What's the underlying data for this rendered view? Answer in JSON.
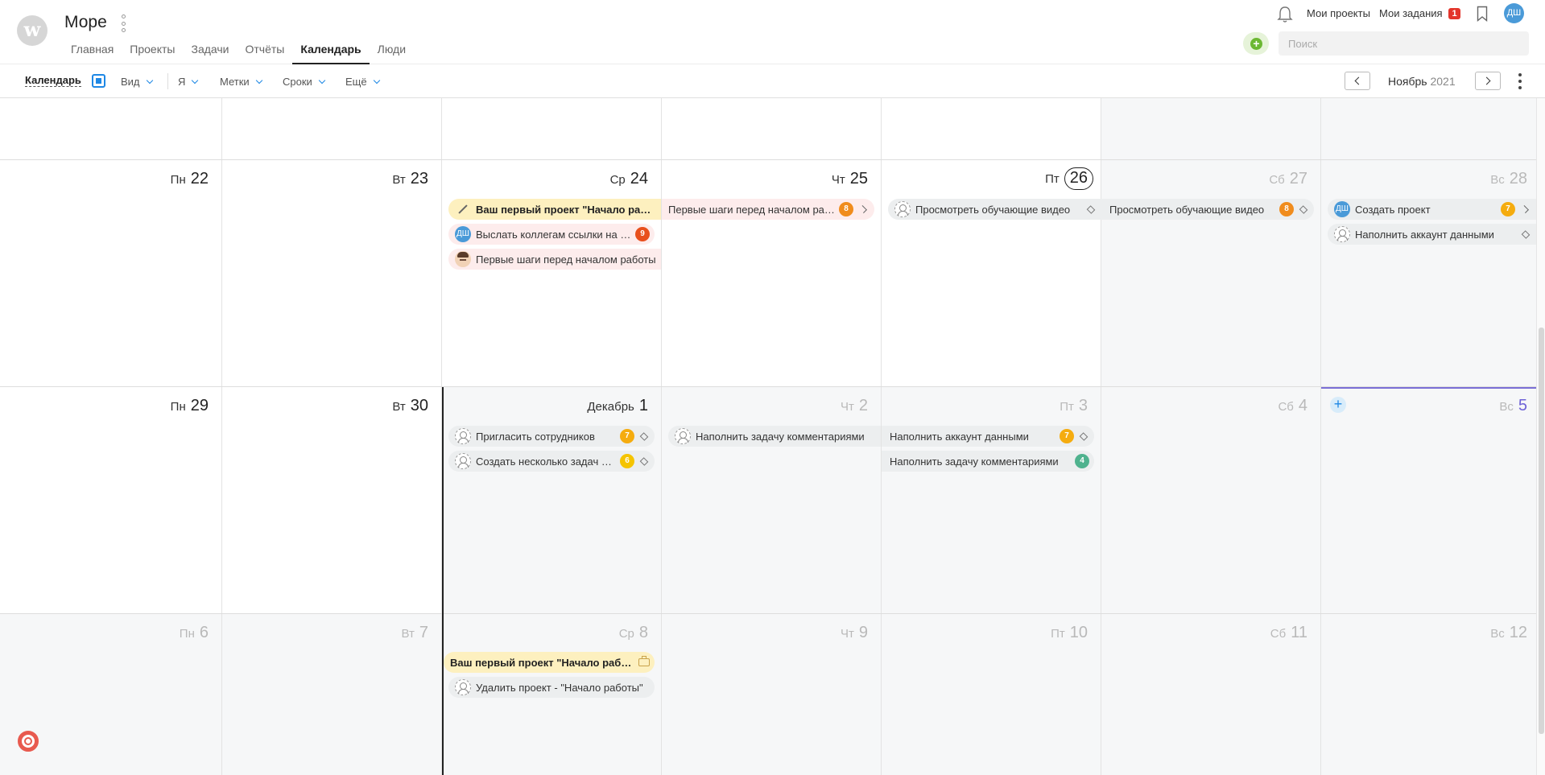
{
  "header": {
    "logo_letter": "w",
    "project_title": "Море",
    "nav": [
      "Главная",
      "Проекты",
      "Задачи",
      "Отчёты",
      "Календарь",
      "Люди"
    ],
    "active_nav": "Календарь",
    "my_projects": "Мои проекты",
    "my_tasks": "Мои задания",
    "my_tasks_count": "1",
    "user_initials": "ДШ",
    "search_placeholder": "Поиск"
  },
  "toolbar": {
    "calendar_label": "Календарь",
    "filters": [
      "Вид",
      "Я",
      "Метки",
      "Сроки",
      "Ещё"
    ],
    "month": "Ноябрь",
    "year": "2021"
  },
  "weeks": [
    {
      "days": [
        {
          "wd": "Пн",
          "d": "22"
        },
        {
          "wd": "Вт",
          "d": "23"
        },
        {
          "wd": "Ср",
          "d": "24"
        },
        {
          "wd": "Чт",
          "d": "25"
        },
        {
          "wd": "Пт",
          "d": "26",
          "today": true
        },
        {
          "wd": "Сб",
          "d": "27"
        },
        {
          "wd": "Вс",
          "d": "28"
        }
      ]
    },
    {
      "days": [
        {
          "wd": "Пн",
          "d": "29"
        },
        {
          "wd": "Вт",
          "d": "30"
        },
        {
          "wd": "Декабрь",
          "d": "1"
        },
        {
          "wd": "Чт",
          "d": "2"
        },
        {
          "wd": "Пт",
          "d": "3"
        },
        {
          "wd": "Сб",
          "d": "4"
        },
        {
          "wd": "Вс",
          "d": "5"
        }
      ]
    },
    {
      "days": [
        {
          "wd": "Пн",
          "d": "6"
        },
        {
          "wd": "Вт",
          "d": "7"
        },
        {
          "wd": "Ср",
          "d": "8"
        },
        {
          "wd": "Чт",
          "d": "9"
        },
        {
          "wd": "Пт",
          "d": "10"
        },
        {
          "wd": "Сб",
          "d": "11"
        },
        {
          "wd": "Вс",
          "d": "12"
        }
      ]
    }
  ],
  "tasks": {
    "t1": {
      "text": "Ваш первый проект \"Начало работы\"",
      "kind": "project"
    },
    "t2": {
      "text": "Выслать коллегам ссылки на регистрацию",
      "count": "9"
    },
    "t3": {
      "text": "Первые шаги перед началом работы"
    },
    "t4": {
      "text": "Первые шаги перед началом работы",
      "count": "8"
    },
    "t5": {
      "text": "Просмотреть обучающие видео"
    },
    "t6": {
      "text": "Просмотреть обучающие видео",
      "count": "8"
    },
    "t7": {
      "text": "Создать проект",
      "count": "7"
    },
    "t8": {
      "text": "Наполнить аккаунт данными"
    },
    "t9": {
      "text": "Пригласить сотрудников",
      "count": "7"
    },
    "t10": {
      "text": "Создать несколько задач в проекте",
      "count": "6"
    },
    "t11": {
      "text": "Наполнить задачу комментариями"
    },
    "t12": {
      "text": "Наполнить аккаунт данными",
      "count": "7"
    },
    "t13": {
      "text": "Наполнить задачу комментариями",
      "count": "4"
    },
    "t14": {
      "text": "Ваш первый проект \"Начало работы\"",
      "kind": "project"
    },
    "t15": {
      "text": "Удалить проект - \"Начало работы\""
    }
  },
  "colors": {
    "accent": "#1e88e5",
    "badge_red": "#e3352b",
    "count_orange": "#f08c1d",
    "count_green": "#4fb28e",
    "project_bar": "#fdf0bf",
    "sunday_purple": "#6e62d6"
  }
}
